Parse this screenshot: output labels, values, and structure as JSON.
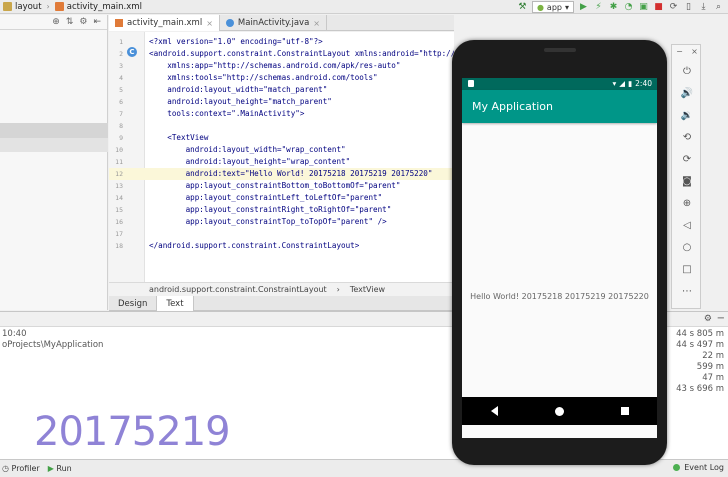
{
  "toolbar": {
    "crumbs": [
      "layout",
      "activity_main.xml"
    ],
    "run_config": "app"
  },
  "tabs": [
    {
      "label": "activity_main.xml",
      "active": true
    },
    {
      "label": "MainActivity.java",
      "active": false
    }
  ],
  "code_lines": [
    {
      "n": "1",
      "text": "<?xml version=\"1.0\" encoding=\"utf-8\"?>"
    },
    {
      "n": "2",
      "text": "<android.support.constraint.ConstraintLayout xmlns:android=\"http://schemas.and"
    },
    {
      "n": "3",
      "text": "    xmlns:app=\"http://schemas.android.com/apk/res-auto\""
    },
    {
      "n": "4",
      "text": "    xmlns:tools=\"http://schemas.android.com/tools\""
    },
    {
      "n": "5",
      "text": "    android:layout_width=\"match_parent\""
    },
    {
      "n": "6",
      "text": "    android:layout_height=\"match_parent\""
    },
    {
      "n": "7",
      "text": "    tools:context=\".MainActivity\">"
    },
    {
      "n": "8",
      "text": ""
    },
    {
      "n": "9",
      "text": "    <TextView"
    },
    {
      "n": "10",
      "text": "        android:layout_width=\"wrap_content\""
    },
    {
      "n": "11",
      "text": "        android:layout_height=\"wrap_content\""
    },
    {
      "n": "12",
      "text": "        android:text=\"Hello World! 20175218 20175219 20175220\""
    },
    {
      "n": "13",
      "text": "        app:layout_constraintBottom_toBottomOf=\"parent\""
    },
    {
      "n": "14",
      "text": "        app:layout_constraintLeft_toLeftOf=\"parent\""
    },
    {
      "n": "15",
      "text": "        app:layout_constraintRight_toRightOf=\"parent\""
    },
    {
      "n": "16",
      "text": "        app:layout_constraintTop_toTopOf=\"parent\" />"
    },
    {
      "n": "17",
      "text": ""
    },
    {
      "n": "18",
      "text": "</android.support.constraint.ConstraintLayout>"
    }
  ],
  "editor_crumbs": [
    "android.support.constraint.ConstraintLayout",
    "TextView"
  ],
  "design_tabs": [
    {
      "label": "Design",
      "active": false
    },
    {
      "label": "Text",
      "active": true
    }
  ],
  "bottom": {
    "time": "10:40",
    "path": "oProjects\\MyApplication",
    "right_values": [
      "44 s 805 m",
      "44 s 497 m",
      "22 m",
      "599 m",
      "47 m",
      "43 s 696 m"
    ],
    "big_number": "20175219"
  },
  "status": {
    "profiler": "Profiler",
    "run": "Run",
    "event_log": "Event Log"
  },
  "emulator": {
    "time": "2:40",
    "app_title": "My Application",
    "hello_text": "Hello World! 20175218 20175219 20175220",
    "accent_color": "#009688"
  }
}
